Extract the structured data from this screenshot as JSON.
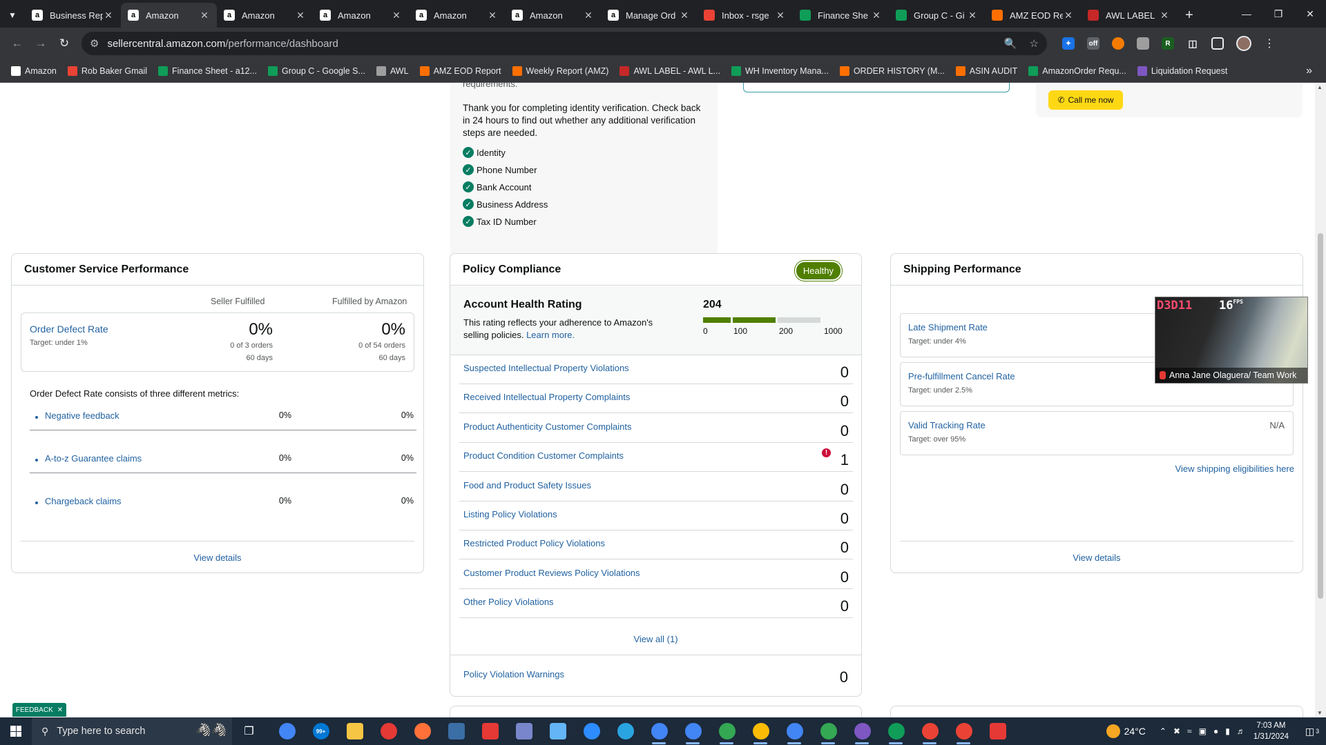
{
  "browser": {
    "tabs": [
      {
        "title": "Business Rep",
        "icon": "amazon-icon",
        "color": "#ffffff",
        "active": false
      },
      {
        "title": "Amazon",
        "icon": "amazon-icon",
        "color": "#ffffff",
        "active": true
      },
      {
        "title": "Amazon",
        "icon": "amazon-icon",
        "color": "#ffffff",
        "active": false
      },
      {
        "title": "Amazon",
        "icon": "amazon-icon",
        "color": "#ffffff",
        "active": false
      },
      {
        "title": "Amazon",
        "icon": "amazon-icon",
        "color": "#ffffff",
        "active": false
      },
      {
        "title": "Amazon",
        "icon": "amazon-icon",
        "color": "#ffffff",
        "active": false
      },
      {
        "title": "Manage Ord",
        "icon": "amazon-icon",
        "color": "#ffffff",
        "active": false
      },
      {
        "title": "Inbox - rsge",
        "icon": "gmail-icon",
        "color": "#ea4335",
        "active": false
      },
      {
        "title": "Finance She",
        "icon": "sheets-icon",
        "color": "#0f9d58",
        "active": false
      },
      {
        "title": "Group C - Gi",
        "icon": "sheets-icon",
        "color": "#0f9d58",
        "active": false
      },
      {
        "title": "AMZ EOD Re",
        "icon": "aws-logo-icon",
        "color": "#ff6f00",
        "active": false
      },
      {
        "title": "AWL LABEL",
        "icon": "awl-icon",
        "color": "#c62828",
        "active": false
      }
    ],
    "url_host": "sellercentral.amazon.com",
    "url_path": "/performance/dashboard",
    "bookmarks": [
      {
        "label": "Amazon",
        "color": "#ffffff"
      },
      {
        "label": "Rob Baker Gmail",
        "color": "#ea4335"
      },
      {
        "label": "Finance Sheet - a12...",
        "color": "#0f9d58"
      },
      {
        "label": "Group C - Google S...",
        "color": "#0f9d58"
      },
      {
        "label": "AWL",
        "color": "#9e9e9e"
      },
      {
        "label": "AMZ EOD Report",
        "color": "#ff6f00"
      },
      {
        "label": "Weekly Report (AMZ)",
        "color": "#ff6f00"
      },
      {
        "label": "AWL LABEL - AWL L...",
        "color": "#c62828"
      },
      {
        "label": "WH Inventory Mana...",
        "color": "#0f9d58"
      },
      {
        "label": "ORDER HISTORY (M...",
        "color": "#ff6f00"
      },
      {
        "label": "ASIN AUDIT",
        "color": "#ff6f00"
      },
      {
        "label": "AmazonOrder Requ...",
        "color": "#0f9d58"
      },
      {
        "label": "Liquidation Request",
        "color": "#7e57c2"
      }
    ]
  },
  "verification": {
    "clipped_text": "requirements.",
    "message": "Thank you for completing identity verification. Check back in 24 hours to find out whether any additional verification steps are needed.",
    "items": [
      "Identity",
      "Phone Number",
      "Bank Account",
      "Business Address",
      "Tax ID Number"
    ],
    "call_button": "Call me now"
  },
  "customer_service": {
    "title": "Customer Service Performance",
    "col_seller": "Seller Fulfilled",
    "col_fba": "Fulfilled by Amazon",
    "odr": {
      "label": "Order Defect Rate",
      "target": "Target: under 1%",
      "seller_pct": "0%",
      "seller_orders": "0 of 3 orders",
      "seller_days": "60 days",
      "fba_pct": "0%",
      "fba_orders": "0 of 54 orders",
      "fba_days": "60 days"
    },
    "consists": "Order Defect Rate consists of three different metrics:",
    "metrics": [
      {
        "name": "Negative feedback",
        "seller": "0%",
        "fba": "0%"
      },
      {
        "name": "A-to-z Guarantee claims",
        "seller": "0%",
        "fba": "0%"
      },
      {
        "name": "Chargeback claims",
        "seller": "0%",
        "fba": "0%"
      }
    ],
    "view_details": "View details"
  },
  "policy": {
    "title": "Policy Compliance",
    "status": "Healthy",
    "status_color": "#507f00",
    "ahr_title": "Account Health Rating",
    "ahr_desc": "This rating reflects your adherence to Amazon's selling policies.",
    "ahr_learn": "Learn more.",
    "score": "204",
    "score_value": 204,
    "ticks": [
      "0",
      "100",
      "200",
      "1000"
    ],
    "violations": [
      {
        "name": "Suspected Intellectual Property Violations",
        "count": "0",
        "warn": false
      },
      {
        "name": "Received Intellectual Property Complaints",
        "count": "0",
        "warn": false
      },
      {
        "name": "Product Authenticity Customer Complaints",
        "count": "0",
        "warn": false
      },
      {
        "name": "Product Condition Customer Complaints",
        "count": "1",
        "warn": true
      },
      {
        "name": "Food and Product Safety Issues",
        "count": "0",
        "warn": false
      },
      {
        "name": "Listing Policy Violations",
        "count": "0",
        "warn": false
      },
      {
        "name": "Restricted Product Policy Violations",
        "count": "0",
        "warn": false
      },
      {
        "name": "Customer Product Reviews Policy Violations",
        "count": "0",
        "warn": false
      },
      {
        "name": "Other Policy Violations",
        "count": "0",
        "warn": false
      }
    ],
    "view_all": "View all (1)",
    "warnings_label": "Policy Violation Warnings",
    "warnings_count": "0"
  },
  "shipping": {
    "title": "Shipping Performance",
    "rows": [
      {
        "name": "Late Shipment Rate",
        "target": "Target: under 4%",
        "value": ""
      },
      {
        "name": "Pre-fulfillment Cancel Rate",
        "target": "Target: under 2.5%",
        "value": ""
      },
      {
        "name": "Valid Tracking Rate",
        "target": "Target: over 95%",
        "value": "N/A"
      }
    ],
    "eligibility": "View shipping eligibilities here",
    "view_details": "View details"
  },
  "feedback": "FEEDBACK",
  "webcam": {
    "tag": "D3D11",
    "fps": "16",
    "fps_unit": "FPS",
    "name": "Anna Jane Olaguera/ Team Work"
  },
  "taskbar": {
    "search_placeholder": "Type here to search",
    "mail_badge": "99+",
    "weather": "24°C",
    "time": "7:03 AM",
    "date": "1/31/2024",
    "notif_count": "3",
    "apps": [
      {
        "name": "chrome-icon",
        "color": "#4285f4"
      },
      {
        "name": "mail-icon",
        "color": "#0078d4"
      },
      {
        "name": "file-explorer-icon",
        "color": "#f6c544"
      },
      {
        "name": "multicolor-app-icon",
        "color": "#e53935"
      },
      {
        "name": "firefox-icon",
        "color": "#ff7139"
      },
      {
        "name": "calculator-icon",
        "color": "#3a6ea5"
      },
      {
        "name": "wps-icon",
        "color": "#e53935"
      },
      {
        "name": "paint-icon",
        "color": "#7986cb"
      },
      {
        "name": "notepad-icon",
        "color": "#64b5f6"
      },
      {
        "name": "zoom-icon",
        "color": "#2d8cff"
      },
      {
        "name": "telegram-icon",
        "color": "#2aa4e0"
      },
      {
        "name": "chrome-icon",
        "color": "#4285f4"
      },
      {
        "name": "chrome-icon",
        "color": "#4285f4"
      },
      {
        "name": "chrome-icon",
        "color": "#34a853"
      },
      {
        "name": "chrome-icon",
        "color": "#fbbc05"
      },
      {
        "name": "chrome-icon",
        "color": "#4285f4"
      },
      {
        "name": "chrome-icon",
        "color": "#34a853"
      },
      {
        "name": "chrome-icon",
        "color": "#7e57c2"
      },
      {
        "name": "chrome-icon",
        "color": "#0f9d58"
      },
      {
        "name": "chrome-icon",
        "color": "#ea4335"
      },
      {
        "name": "chrome-icon",
        "color": "#ea4335"
      },
      {
        "name": "remote-app-icon",
        "color": "#e53935"
      }
    ]
  }
}
